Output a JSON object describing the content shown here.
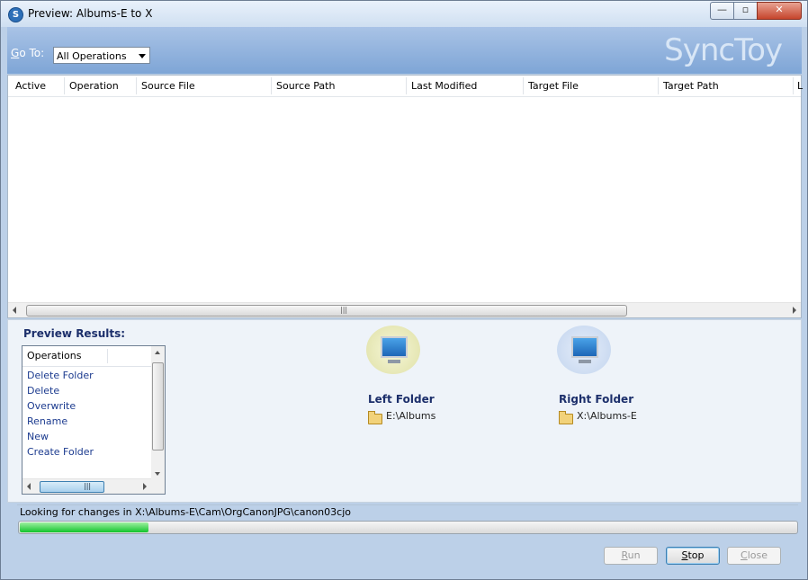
{
  "window": {
    "title": "Preview: Albums-E to X",
    "controls": {
      "minimize": "—",
      "maximize": "▫",
      "close": "✕"
    }
  },
  "header": {
    "goto_label_accel": "G",
    "goto_label_rest": "o To:",
    "goto_selected": "All Operations",
    "brand": "SyncToy"
  },
  "grid": {
    "columns": [
      "Active",
      "Operation",
      "Source File",
      "Source Path",
      "Last Modified",
      "Target File",
      "Target Path",
      "L"
    ],
    "rows": [],
    "scroll_grip": "|||"
  },
  "results": {
    "title": "Preview Results:",
    "operations_header": "Operations",
    "operations": [
      "Delete Folder",
      "Delete",
      "Overwrite",
      "Rename",
      "New",
      "Create Folder"
    ],
    "scroll_grip": "|||"
  },
  "left_folder": {
    "label": "Left Folder",
    "path": "E:\\Albums"
  },
  "right_folder": {
    "label": "Right Folder",
    "path": "X:\\Albums-E"
  },
  "status": {
    "message": "Looking for changes in X:\\Albums-E\\Cam\\OrgCanonJPG\\canon03cjo",
    "progress": 0.165
  },
  "footer": {
    "run": "Run",
    "stop": "Stop",
    "close": "Close"
  }
}
